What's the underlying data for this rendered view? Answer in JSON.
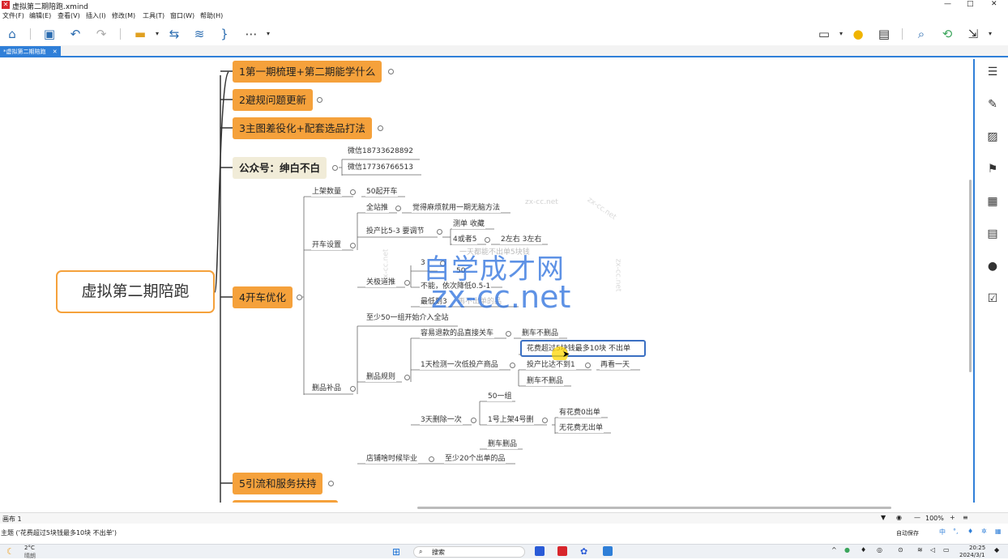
{
  "window": {
    "title": "虚拟第二期陪跑.xmind",
    "controls": [
      "—",
      "□",
      "✕"
    ]
  },
  "menu": [
    "文件(F)",
    "编辑(E)",
    "查看(V)",
    "插入(I)",
    "修改(M)",
    "工具(T)",
    "窗口(W)",
    "帮助(H)"
  ],
  "tab": {
    "label": "*虚拟第二期陪跑",
    "close": "✕"
  },
  "mindmap": {
    "central": "虚拟第二期陪跑",
    "topics": {
      "t1": "1第一期梳理+第二期能学什么",
      "t2": "2避规问题更新",
      "t3": "3主图差役化+配套选品打法",
      "t4_pub": "公众号：绅白不白",
      "t5": "4开车优化",
      "t6": "5引流和服务扶持"
    },
    "wechat": [
      "微信18733628892",
      "微信17736766513"
    ],
    "open_car": {
      "shangjia": "上架数量",
      "shangjia_v": "50起开车",
      "kaiche": "开车设置",
      "quanzhan": "全站推",
      "quanzhan_v": "觉得麻烦就用一期无脑方法",
      "touchan": "投产比5-3 要调节",
      "cedan": "测单 收藏",
      "huozhe": "4或者5",
      "zuoyou": "2左右 3左右",
      "guanji": "关极道推",
      "san": "3",
      "wu": "50",
      "buneng": "不能，依次降低0.5-1",
      "zuidi": "最低到3",
      "hidden1": "一天都能不出单5块钱",
      "hidden2": "再不出单的品",
      "shanpin": "删品补品",
      "zhishao50": "至少50一组开始介入全站",
      "shanpinguize": "删品规则",
      "rongyi": "容易退款的品直接关车",
      "ganche": "删车不删品",
      "huafei": "花费超过5块钱最多10块 不出单",
      "yitian": "1天检测一次低投产商品",
      "touchanbi": "投产比达不到1",
      "zaikan": "再看一天",
      "gancheb": "删车不删品",
      "santian": "3天删除一次",
      "wushi": "50一组",
      "yihao": "1号上架4号删",
      "youhua": "有花费0出单",
      "wuhua": "无花费无出单",
      "shanche": "删车删品",
      "dianpu": "店铺啥时候毕业",
      "dianpu_v": "至少20个出单的品"
    }
  },
  "watermark": {
    "line1": "自学成才网",
    "line2": "zx-cc.net",
    "small": "zx-cc.net"
  },
  "sheet": {
    "label": "画布 1",
    "zoom": "100%",
    "minus": "—",
    "plus": "+"
  },
  "status": {
    "text": "主题 ('花费超过5块钱最多10块 不出单')",
    "right": "自动保存"
  },
  "taskbar": {
    "weather_temp": "2°C",
    "weather_desc": "晴朗",
    "search": "搜索",
    "time": "20:25",
    "date": "2024/3/1",
    "ime": "中"
  },
  "colors": {
    "topic": "#f5a13b",
    "accent": "#2f7fd8",
    "central_border": "#f5a13b",
    "selected": "#3a6fc2"
  }
}
